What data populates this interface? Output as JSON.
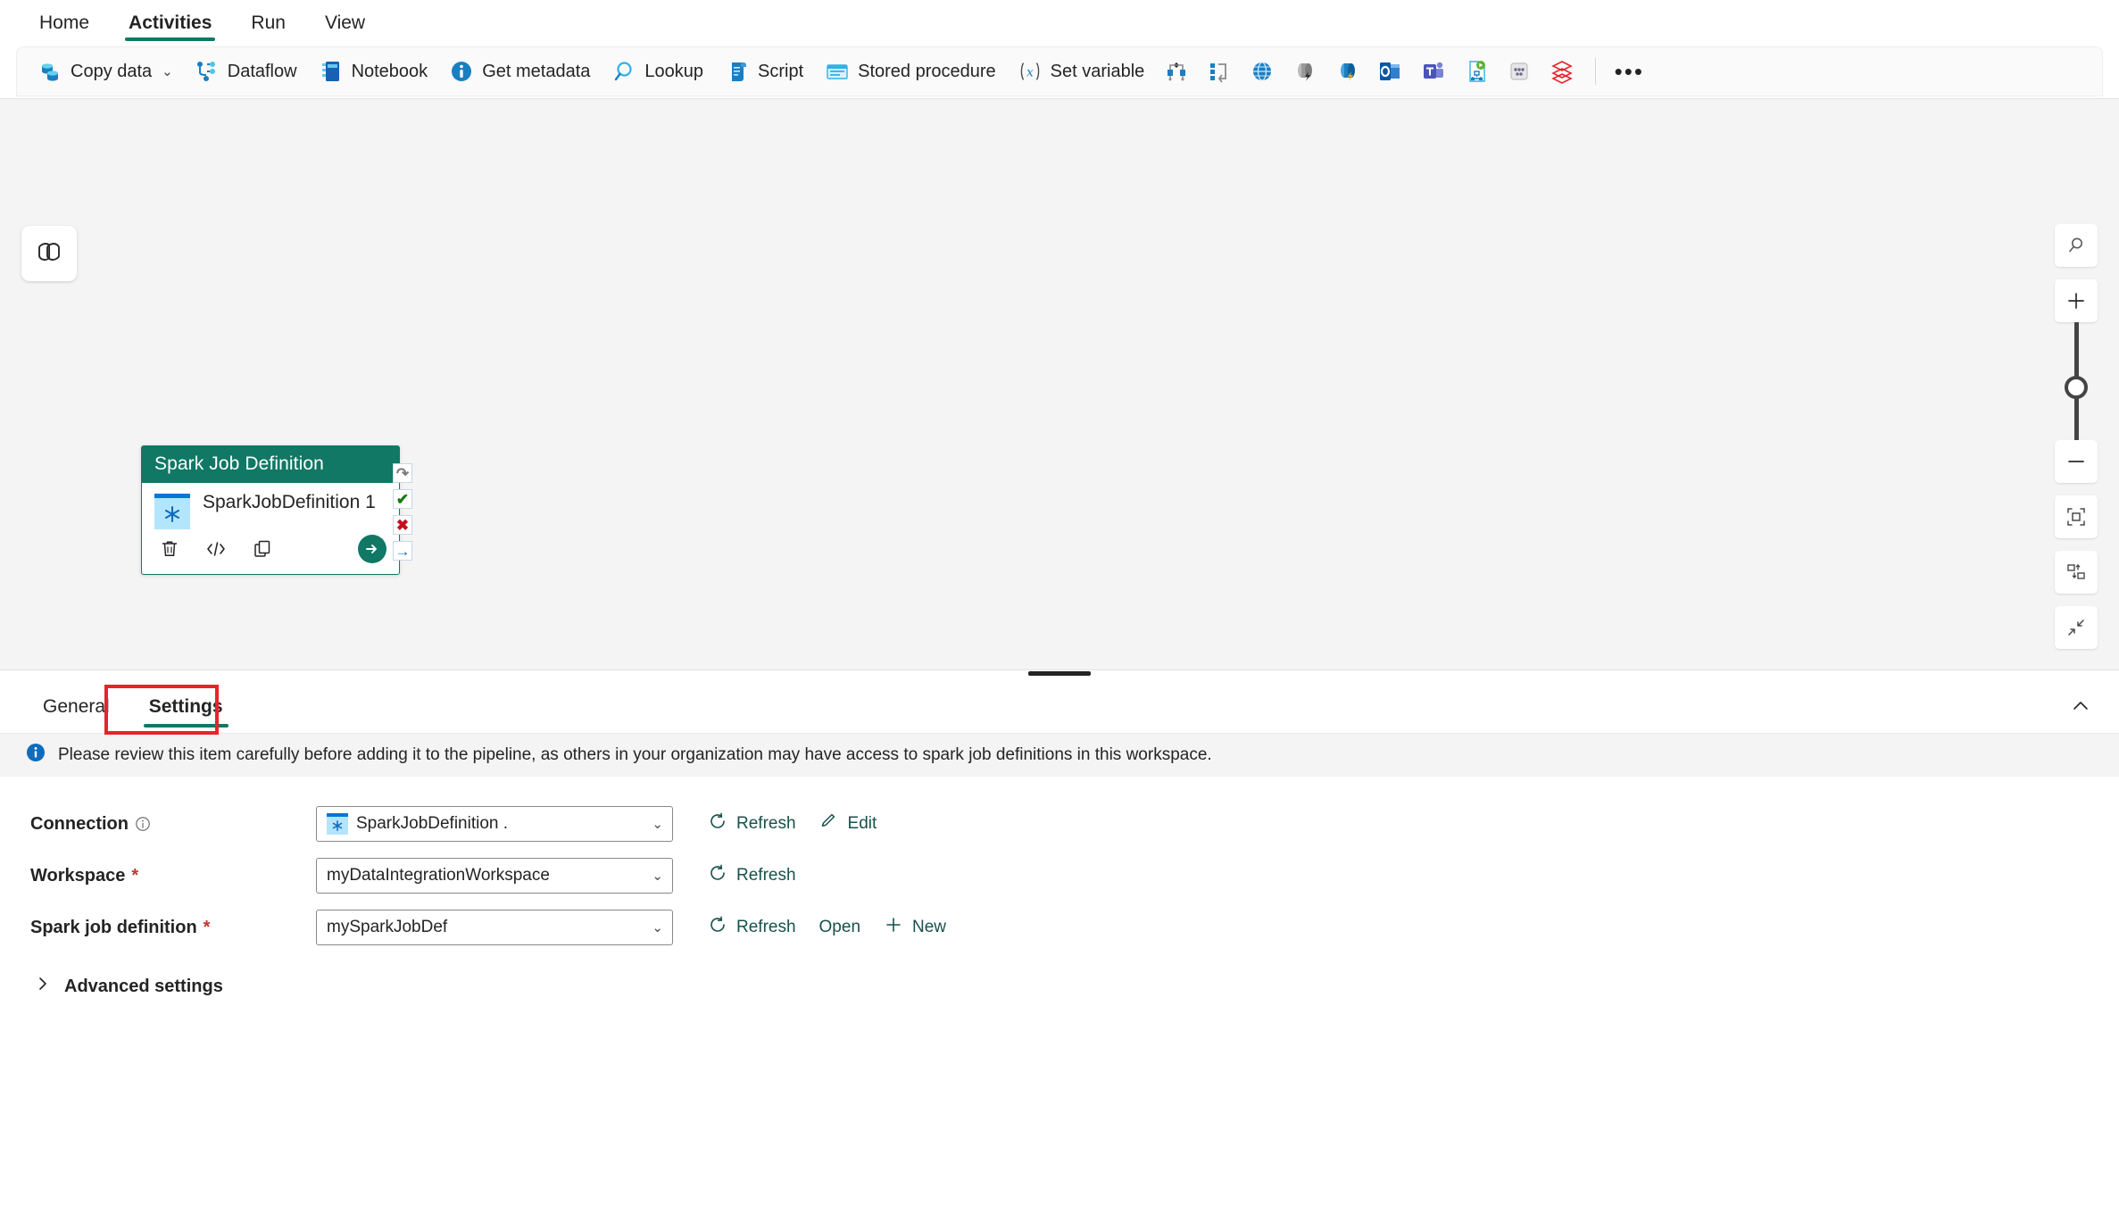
{
  "ribbon": {
    "tabs": [
      {
        "label": "Home",
        "active": false
      },
      {
        "label": "Activities",
        "active": true
      },
      {
        "label": "Run",
        "active": false
      },
      {
        "label": "View",
        "active": false
      }
    ]
  },
  "commandbar": {
    "items": [
      {
        "label": "Copy data",
        "icon": "copy-data-icon",
        "has_chevron": true
      },
      {
        "label": "Dataflow",
        "icon": "dataflow-icon",
        "has_chevron": false
      },
      {
        "label": "Notebook",
        "icon": "notebook-icon",
        "has_chevron": false
      },
      {
        "label": "Get metadata",
        "icon": "get-metadata-icon",
        "has_chevron": false
      },
      {
        "label": "Lookup",
        "icon": "lookup-icon",
        "has_chevron": false
      },
      {
        "label": "Script",
        "icon": "script-icon",
        "has_chevron": false
      },
      {
        "label": "Stored procedure",
        "icon": "stored-procedure-icon",
        "has_chevron": false
      },
      {
        "label": "Set variable",
        "icon": "set-variable-icon",
        "has_chevron": false
      }
    ],
    "icon_only_items": [
      {
        "icon": "switch-activity-icon"
      },
      {
        "icon": "foreach-activity-icon"
      },
      {
        "icon": "web-activity-icon"
      },
      {
        "icon": "webhook-gray-icon"
      },
      {
        "icon": "webhook-blue-icon"
      },
      {
        "icon": "outlook-icon"
      },
      {
        "icon": "teams-icon"
      },
      {
        "icon": "office365-script-icon"
      },
      {
        "icon": "azure-batch-icon"
      },
      {
        "icon": "databricks-icon"
      }
    ],
    "overflow_label": "•••"
  },
  "canvas": {
    "logo_icon": "fabric-pipeline-logo-icon",
    "node": {
      "header": "Spark Job Definition",
      "title": "SparkJobDefinition 1",
      "type_icon": "spark-job-definition-icon",
      "header_color": "#107865",
      "actions": [
        {
          "name": "delete-activity",
          "icon": "trash-icon"
        },
        {
          "name": "view-code",
          "icon": "code-icon"
        },
        {
          "name": "clone-activity",
          "icon": "copy-icon"
        }
      ],
      "run_button_icon": "arrow-right-circle-icon",
      "handles": [
        {
          "name": "on-completion",
          "glyph": "↷",
          "color": "#7a7a7a"
        },
        {
          "name": "on-success",
          "glyph": "✔",
          "color": "#107c10"
        },
        {
          "name": "on-failure",
          "glyph": "✖",
          "color": "#c50f1f"
        },
        {
          "name": "on-skip",
          "glyph": "→",
          "color": "#0f6cbd"
        }
      ]
    },
    "tools": [
      {
        "name": "zoom-search-button",
        "icon": "search-icon"
      },
      {
        "name": "zoom-in-button",
        "icon": "plus-icon"
      },
      {
        "name": "zoom-slider",
        "icon": "slider-thumb"
      },
      {
        "name": "zoom-out-button",
        "icon": "minus-icon"
      },
      {
        "name": "fit-to-screen-button",
        "icon": "fit-screen-icon"
      },
      {
        "name": "auto-layout-button",
        "icon": "auto-layout-icon"
      },
      {
        "name": "collapse-canvas-button",
        "icon": "collapse-arrows-icon"
      }
    ]
  },
  "panel": {
    "tabs": [
      {
        "label": "General",
        "active": false
      },
      {
        "label": "Settings",
        "active": true
      }
    ],
    "highlighted_tab": "Settings",
    "highlight_color": "#e8232a",
    "collapse_icon": "chevron-up-icon",
    "info_message": "Please review this item carefully before adding it to the pipeline, as others in your organization may have access to spark job definitions in this workspace.",
    "info_icon": "info-icon",
    "fields": [
      {
        "label": "Connection",
        "required": false,
        "has_info_icon": true,
        "value": "SparkJobDefinition .",
        "value_icon": "spark-job-definition-icon",
        "actions": [
          {
            "label": "Refresh",
            "icon": "refresh-icon"
          },
          {
            "label": "Edit",
            "icon": "pencil-icon"
          }
        ]
      },
      {
        "label": "Workspace",
        "required": true,
        "has_info_icon": false,
        "value": "myDataIntegrationWorkspace",
        "value_icon": null,
        "actions": [
          {
            "label": "Refresh",
            "icon": "refresh-icon"
          }
        ]
      },
      {
        "label": "Spark job definition",
        "required": true,
        "has_info_icon": false,
        "value": "mySparkJobDef",
        "value_icon": null,
        "actions": [
          {
            "label": "Refresh",
            "icon": "refresh-icon"
          },
          {
            "label": "Open",
            "icon": null
          },
          {
            "label": "New",
            "icon": "plus-icon"
          }
        ]
      }
    ],
    "advanced_settings_label": "Advanced settings",
    "advanced_settings_icon": "chevron-right-icon"
  }
}
